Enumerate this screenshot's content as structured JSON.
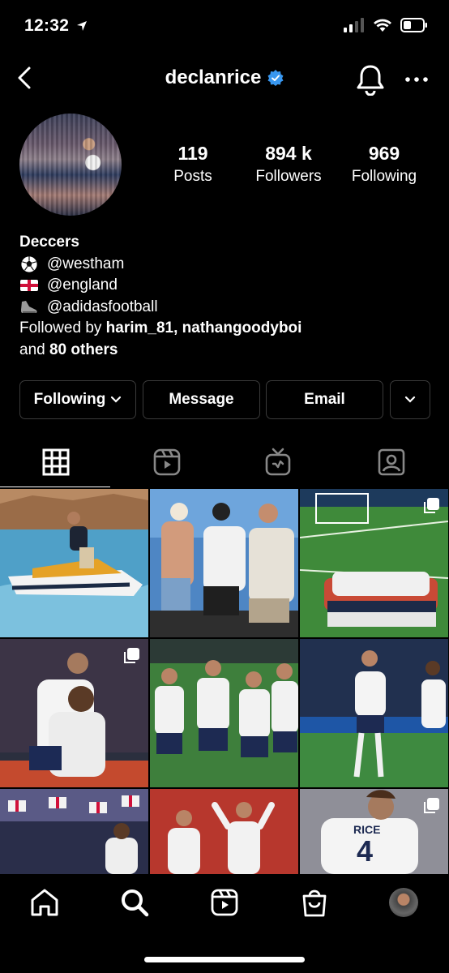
{
  "status_bar": {
    "time": "12:32",
    "icons": [
      "location-arrow-icon",
      "cellular-signal-icon",
      "wifi-icon",
      "battery-icon"
    ]
  },
  "header": {
    "username": "declanrice",
    "verified": true,
    "icons": [
      "back-chevron-icon",
      "verified-badge-icon",
      "bell-icon",
      "more-horizontal-icon"
    ]
  },
  "stats": {
    "posts": {
      "value": "119",
      "label": "Posts"
    },
    "followers": {
      "value": "894 k",
      "label": "Followers"
    },
    "following": {
      "value": "969",
      "label": "Following"
    }
  },
  "bio": {
    "name": "Deccers",
    "lines": [
      {
        "icon": "soccer-ball-icon",
        "text": "@westham"
      },
      {
        "icon": "england-flag-icon",
        "text": "@england"
      },
      {
        "icon": "sneaker-icon",
        "text": "@adidasfootball"
      }
    ],
    "followed_by_prefix": "Followed by ",
    "followed_by_names": "harim_81, nathangoodyboi",
    "and_prefix": "and ",
    "others": "80 others"
  },
  "actions": {
    "following": "Following",
    "message": "Message",
    "email": "Email"
  },
  "tabs": [
    "grid-icon",
    "reels-icon",
    "igtv-icon",
    "tagged-icon"
  ],
  "grid": {
    "posts": [
      {
        "id": "jetski-photo",
        "multi": false
      },
      {
        "id": "friends-boat-photo",
        "multi": false
      },
      {
        "id": "team-huddle-photo",
        "multi": true
      },
      {
        "id": "celebration-hug-photo",
        "multi": true
      },
      {
        "id": "team-celebration-photo",
        "multi": false
      },
      {
        "id": "stadium-celebration-photo",
        "multi": false
      },
      {
        "id": "crowd-flags-photo",
        "multi": false
      },
      {
        "id": "fans-celebration-photo",
        "multi": false
      },
      {
        "id": "rice-shirt-photo",
        "multi": true
      }
    ],
    "rice_shirt_text": "RICE",
    "rice_shirt_number": "4"
  },
  "bottom_nav": [
    "home-icon",
    "search-icon",
    "reels-icon",
    "shop-icon",
    "profile-avatar"
  ],
  "colors": {
    "verified": "#3897f0",
    "background": "#000000",
    "border": "#3a3a3a"
  }
}
